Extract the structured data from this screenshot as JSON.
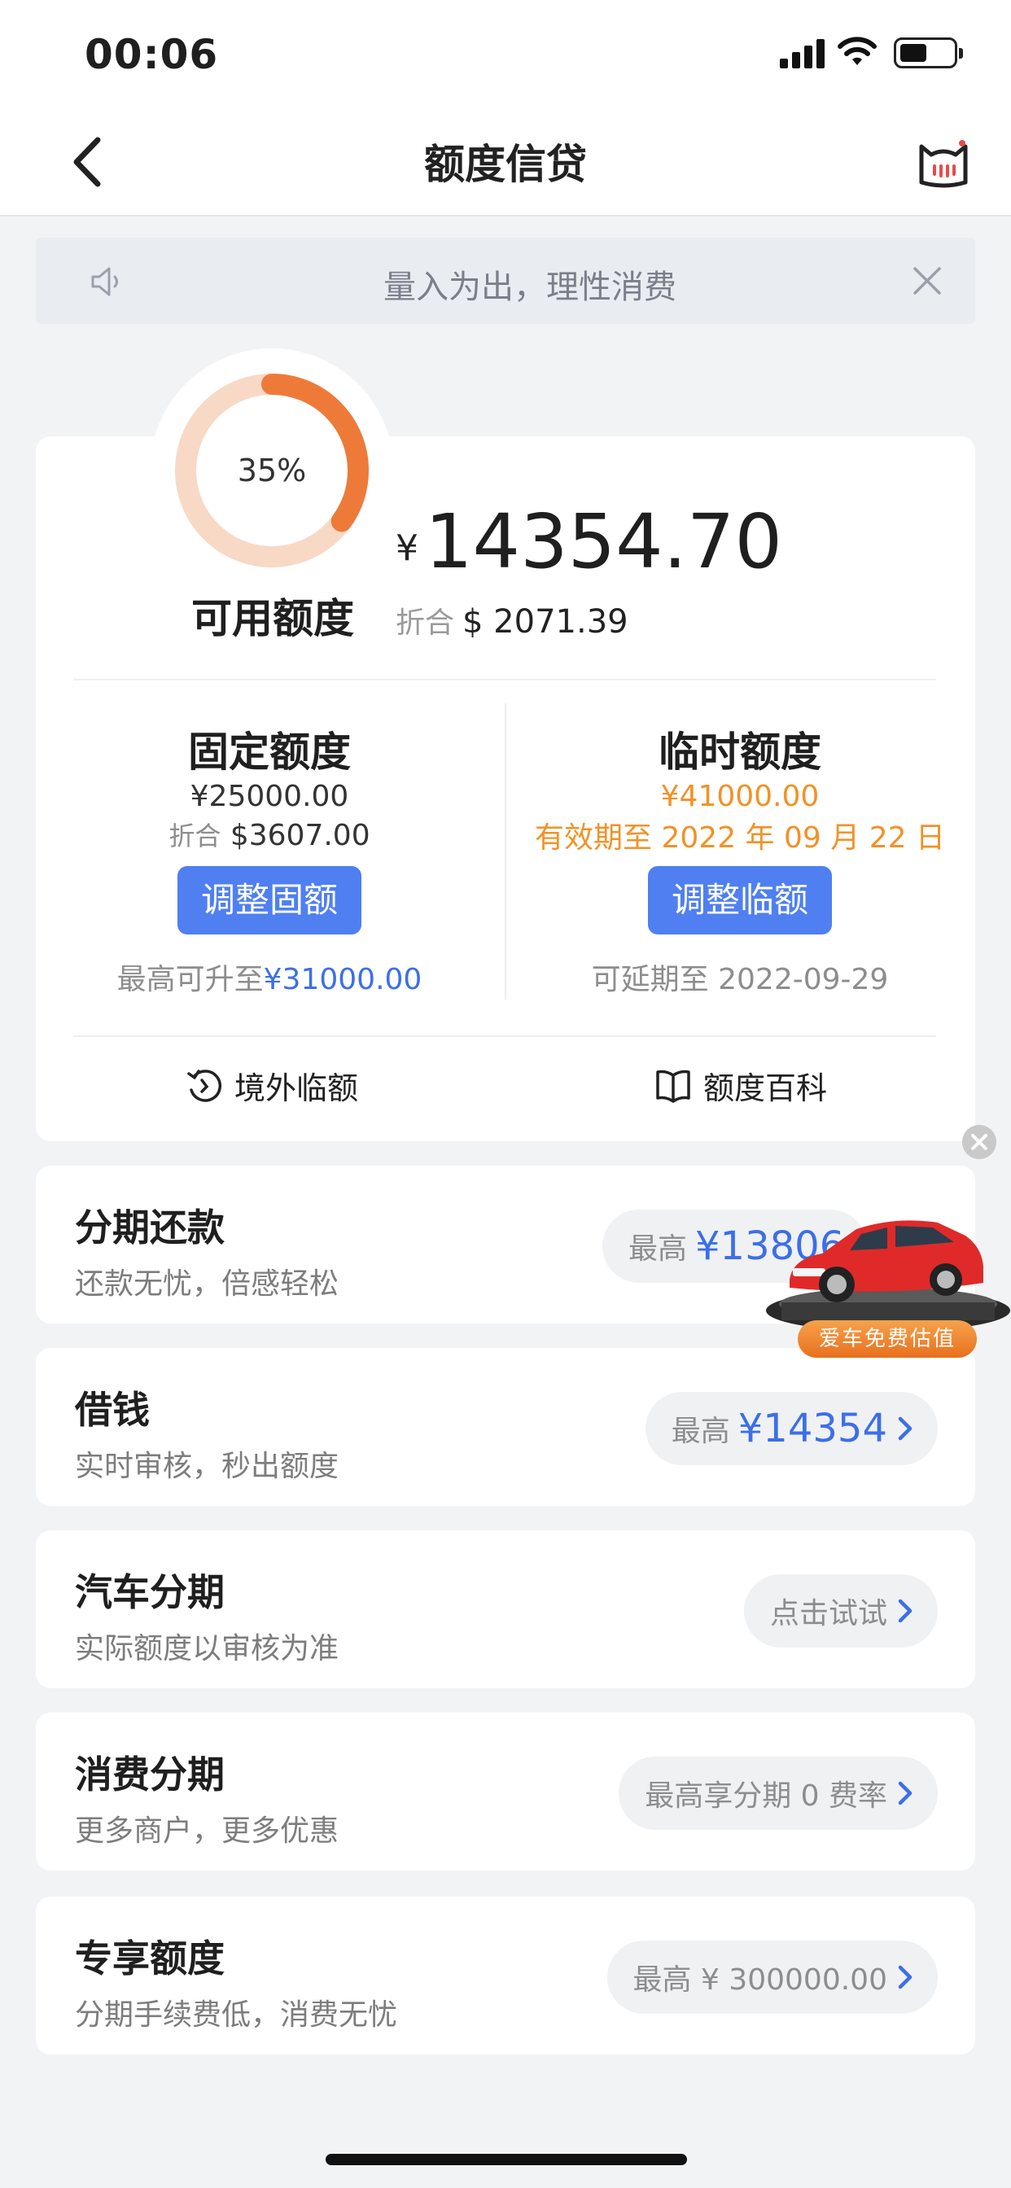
{
  "status_bar": {
    "time": "00:06"
  },
  "nav": {
    "title": "额度信贷"
  },
  "notice": {
    "text": "量入为出，理性消费"
  },
  "credit": {
    "percent_label": "35%",
    "percent_value": 35,
    "available_label": "可用额度",
    "currency_symbol": "¥",
    "available_amount": "14354.70",
    "converted_label": "折合",
    "converted_amount": "$ 2071.39"
  },
  "fixed": {
    "title": "固定额度",
    "amount": "¥25000.00",
    "converted_label": "折合",
    "converted_amount": "$3607.00",
    "button": "调整固额",
    "max_prefix": "最高可升至",
    "max_amount": "¥31000.00"
  },
  "temp": {
    "title": "临时额度",
    "amount": "¥41000.00",
    "validity": "有效期至 2022 年 09 月 22 日",
    "button": "调整临额",
    "extend": "可延期至 2022-09-29"
  },
  "links": {
    "overseas": "境外临额",
    "wiki": "额度百科"
  },
  "items": [
    {
      "title": "分期还款",
      "subtitle": "还款无忧，倍感轻松",
      "pill_prefix": "最高",
      "pill_value": "¥13806"
    },
    {
      "title": "借钱",
      "subtitle": "实时审核，秒出额度",
      "pill_prefix": "最高",
      "pill_value": "¥14354"
    },
    {
      "title": "汽车分期",
      "subtitle": "实际额度以审核为准",
      "pill_prefix": "点击试试",
      "pill_value": ""
    },
    {
      "title": "消费分期",
      "subtitle": "更多商户，更多优惠",
      "pill_prefix": "最高享分期 0 费率",
      "pill_value": ""
    },
    {
      "title": "专享额度",
      "subtitle": "分期手续费低，消费无忧",
      "pill_prefix": "最高 ¥ 300000.00",
      "pill_value": ""
    }
  ],
  "ad": {
    "badge": "爱车免费估值"
  },
  "colors": {
    "accent_blue": "#4f7ff1",
    "orange": "#f29226",
    "ring": "#ee7a3a",
    "ring_track": "#f8d9c6"
  }
}
